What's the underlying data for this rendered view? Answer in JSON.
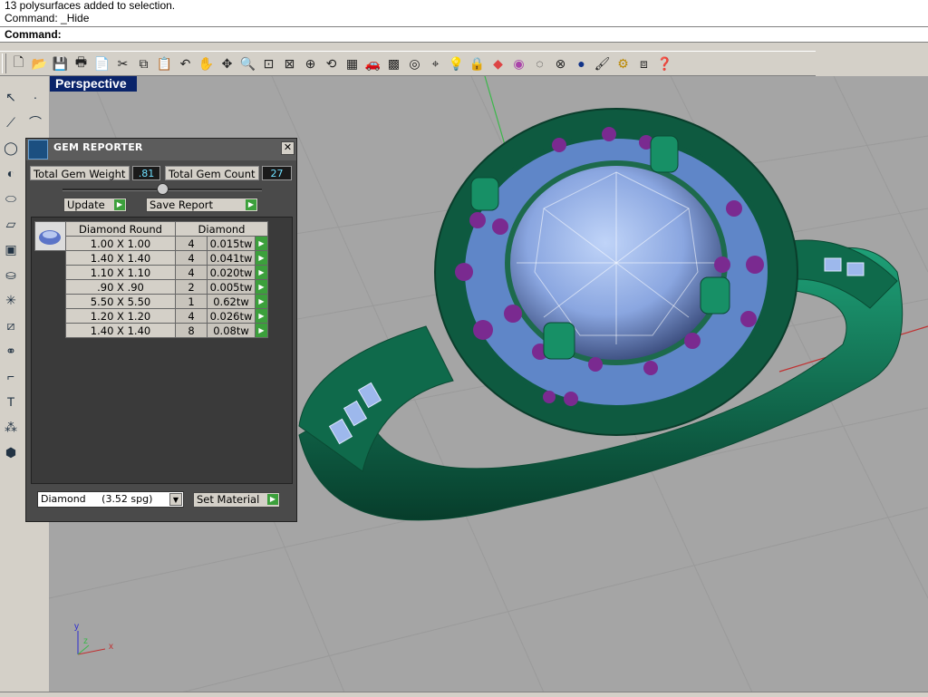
{
  "history": [
    "13 polysurfaces added to selection.",
    "Command: _Hide"
  ],
  "command": {
    "label": "Command:"
  },
  "toolbar_icons": [
    "new-icon",
    "open-icon",
    "save-icon",
    "print-icon",
    "import-icon",
    "cut-icon",
    "copy-icon",
    "paste-icon",
    "undo-icon",
    "pan-hand-icon",
    "rotate-view-icon",
    "zoom-icon",
    "zoom-window-icon",
    "zoom-extents-icon",
    "zoom-selected-icon",
    "undo-view-icon",
    "four-views-icon",
    "car-icon",
    "grid-icon",
    "osnap-icon",
    "osnap-settings-icon",
    "light-bulb-icon",
    "lock-icon",
    "layers-icon",
    "color-wheel-icon",
    "wireframe-sphere-icon",
    "render-sphere-icon",
    "shaded-sphere-icon",
    "lamp-icon",
    "gear-icon",
    "group-icon",
    "help-icon"
  ],
  "viewport": {
    "title": "Perspective"
  },
  "axes": {
    "x": "x",
    "y": "y",
    "z": "z"
  },
  "gem_reporter": {
    "title": "GEM REPORTER",
    "total_weight_label": "Total Gem Weight",
    "total_weight_value": ".81",
    "total_count_label": "Total Gem Count",
    "total_count_value": "27",
    "update_label": "Update",
    "save_report_label": "Save Report",
    "columns": [
      "Diamond Round",
      "Diamond"
    ],
    "rows": [
      {
        "size": "1.00 X 1.00",
        "count": "4",
        "weight": "0.015tw"
      },
      {
        "size": "1.40 X 1.40",
        "count": "4",
        "weight": "0.041tw"
      },
      {
        "size": "1.10 X 1.10",
        "count": "4",
        "weight": "0.020tw"
      },
      {
        "size": ".90 X .90",
        "count": "2",
        "weight": "0.005tw"
      },
      {
        "size": "5.50 X 5.50",
        "count": "1",
        "weight": "0.62tw"
      },
      {
        "size": "1.20 X 1.20",
        "count": "4",
        "weight": "0.026tw"
      },
      {
        "size": "1.40 X 1.40",
        "count": "8",
        "weight": "0.08tw"
      }
    ],
    "material_value": "Diamond     (3.52 spg)",
    "set_material_label": "Set Material"
  },
  "colors": {
    "ring": "#127a55",
    "gem": "#9db8ec",
    "amethyst": "#7a2a90",
    "viewport_bg": "#a5a5a5"
  }
}
